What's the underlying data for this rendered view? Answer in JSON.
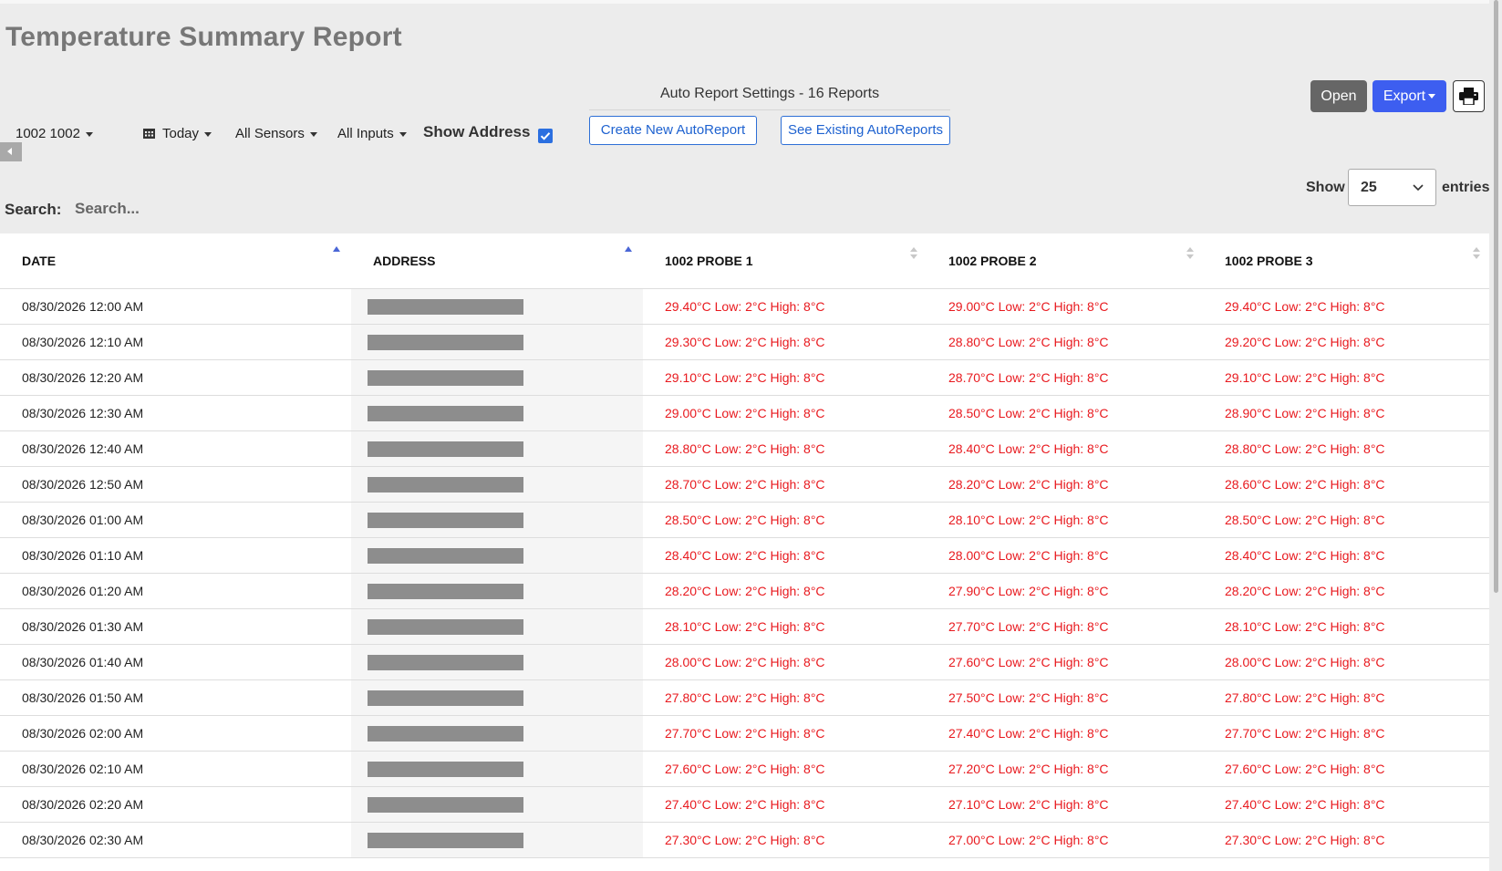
{
  "page_title": "Temperature Summary Report",
  "auto_report": {
    "title": "Auto Report Settings - 16 Reports",
    "create_label": "Create New AutoReport",
    "existing_label": "See Existing AutoReports"
  },
  "filters": {
    "device": "1002 1002",
    "date_range": "Today",
    "sensors": "All Sensors",
    "inputs": "All Inputs",
    "show_address_label": "Show Address",
    "show_address_checked": true
  },
  "actions": {
    "open_label": "Open",
    "export_label": "Export"
  },
  "entries": {
    "show_label": "Show",
    "count": "25",
    "entries_label": "entries"
  },
  "search": {
    "label": "Search:",
    "placeholder": "Search..."
  },
  "table": {
    "headers": [
      "DATE",
      "ADDRESS",
      "1002 PROBE 1",
      "1002 PROBE 2",
      "1002 PROBE 3"
    ],
    "rows": [
      {
        "date": "08/30/2026 12:00 AM",
        "p1": "29.40°C Low: 2°C High: 8°C",
        "p2": "29.00°C Low: 2°C High: 8°C",
        "p3": "29.40°C Low: 2°C High: 8°C"
      },
      {
        "date": "08/30/2026 12:10 AM",
        "p1": "29.30°C Low: 2°C High: 8°C",
        "p2": "28.80°C Low: 2°C High: 8°C",
        "p3": "29.20°C Low: 2°C High: 8°C"
      },
      {
        "date": "08/30/2026 12:20 AM",
        "p1": "29.10°C Low: 2°C High: 8°C",
        "p2": "28.70°C Low: 2°C High: 8°C",
        "p3": "29.10°C Low: 2°C High: 8°C"
      },
      {
        "date": "08/30/2026 12:30 AM",
        "p1": "29.00°C Low: 2°C High: 8°C",
        "p2": "28.50°C Low: 2°C High: 8°C",
        "p3": "28.90°C Low: 2°C High: 8°C"
      },
      {
        "date": "08/30/2026 12:40 AM",
        "p1": "28.80°C Low: 2°C High: 8°C",
        "p2": "28.40°C Low: 2°C High: 8°C",
        "p3": "28.80°C Low: 2°C High: 8°C"
      },
      {
        "date": "08/30/2026 12:50 AM",
        "p1": "28.70°C Low: 2°C High: 8°C",
        "p2": "28.20°C Low: 2°C High: 8°C",
        "p3": "28.60°C Low: 2°C High: 8°C"
      },
      {
        "date": "08/30/2026 01:00 AM",
        "p1": "28.50°C Low: 2°C High: 8°C",
        "p2": "28.10°C Low: 2°C High: 8°C",
        "p3": "28.50°C Low: 2°C High: 8°C"
      },
      {
        "date": "08/30/2026 01:10 AM",
        "p1": "28.40°C Low: 2°C High: 8°C",
        "p2": "28.00°C Low: 2°C High: 8°C",
        "p3": "28.40°C Low: 2°C High: 8°C"
      },
      {
        "date": "08/30/2026 01:20 AM",
        "p1": "28.20°C Low: 2°C High: 8°C",
        "p2": "27.90°C Low: 2°C High: 8°C",
        "p3": "28.20°C Low: 2°C High: 8°C"
      },
      {
        "date": "08/30/2026 01:30 AM",
        "p1": "28.10°C Low: 2°C High: 8°C",
        "p2": "27.70°C Low: 2°C High: 8°C",
        "p3": "28.10°C Low: 2°C High: 8°C"
      },
      {
        "date": "08/30/2026 01:40 AM",
        "p1": "28.00°C Low: 2°C High: 8°C",
        "p2": "27.60°C Low: 2°C High: 8°C",
        "p3": "28.00°C Low: 2°C High: 8°C"
      },
      {
        "date": "08/30/2026 01:50 AM",
        "p1": "27.80°C Low: 2°C High: 8°C",
        "p2": "27.50°C Low: 2°C High: 8°C",
        "p3": "27.80°C Low: 2°C High: 8°C"
      },
      {
        "date": "08/30/2026 02:00 AM",
        "p1": "27.70°C Low: 2°C High: 8°C",
        "p2": "27.40°C Low: 2°C High: 8°C",
        "p3": "27.70°C Low: 2°C High: 8°C"
      },
      {
        "date": "08/30/2026 02:10 AM",
        "p1": "27.60°C Low: 2°C High: 8°C",
        "p2": "27.20°C Low: 2°C High: 8°C",
        "p3": "27.60°C Low: 2°C High: 8°C"
      },
      {
        "date": "08/30/2026 02:20 AM",
        "p1": "27.40°C Low: 2°C High: 8°C",
        "p2": "27.10°C Low: 2°C High: 8°C",
        "p3": "27.40°C Low: 2°C High: 8°C"
      },
      {
        "date": "08/30/2026 02:30 AM",
        "p1": "27.30°C Low: 2°C High: 8°C",
        "p2": "27.00°C Low: 2°C High: 8°C",
        "p3": "27.30°C Low: 2°C High: 8°C"
      }
    ]
  },
  "colors": {
    "alarm_text": "#e8191e",
    "export_button": "#3d5ef0",
    "open_button": "#666666",
    "link_blue": "#1e62d0"
  },
  "icons": {
    "date_range": "calendar-icon",
    "print": "printer-icon",
    "collapse": "chevron-left-icon",
    "select": "chevron-down-icon"
  }
}
